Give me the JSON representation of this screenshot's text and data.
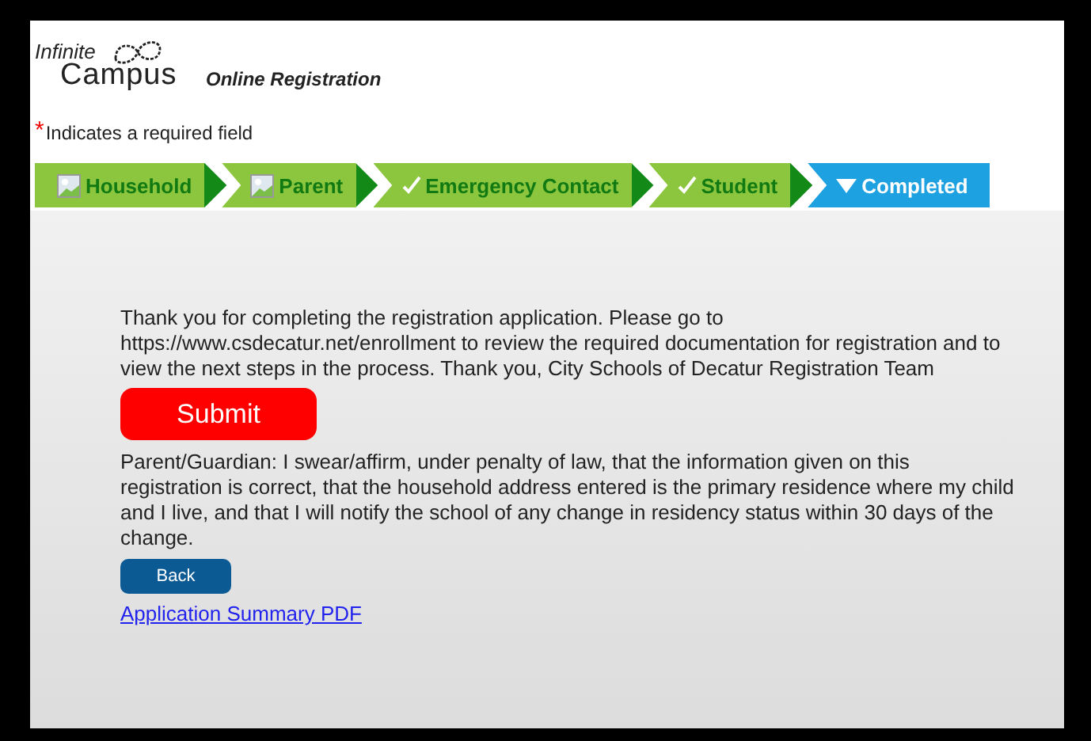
{
  "header": {
    "logo_top": "Infinite",
    "logo_bottom": "Campus",
    "title": "Online Registration"
  },
  "required_note": {
    "mark": "*",
    "text": "Indicates a required field"
  },
  "steps": [
    {
      "label": "Household",
      "kind": "image",
      "selected": false
    },
    {
      "label": "Parent",
      "kind": "image",
      "selected": false
    },
    {
      "label": "Emergency Contact",
      "kind": "check",
      "selected": false
    },
    {
      "label": "Student",
      "kind": "check",
      "selected": false
    },
    {
      "label": "Completed",
      "kind": "down",
      "selected": true
    }
  ],
  "message": "Thank you for completing the registration application. Please go to https://www.csdecatur.net/enrollment to review the required documentation for registration and to view the next steps in the process. Thank you, City Schools of Decatur Registration Team",
  "submit_button": "Submit",
  "affirmation": "Parent/Guardian: I swear/affirm, under penalty of law, that the information given on this registration is correct, that the household address entered is the primary residence where my child and I live, and that I will notify the school of any change in residency status within 30 days of the change.",
  "back_button": "Back",
  "summary_link": "Application Summary PDF"
}
